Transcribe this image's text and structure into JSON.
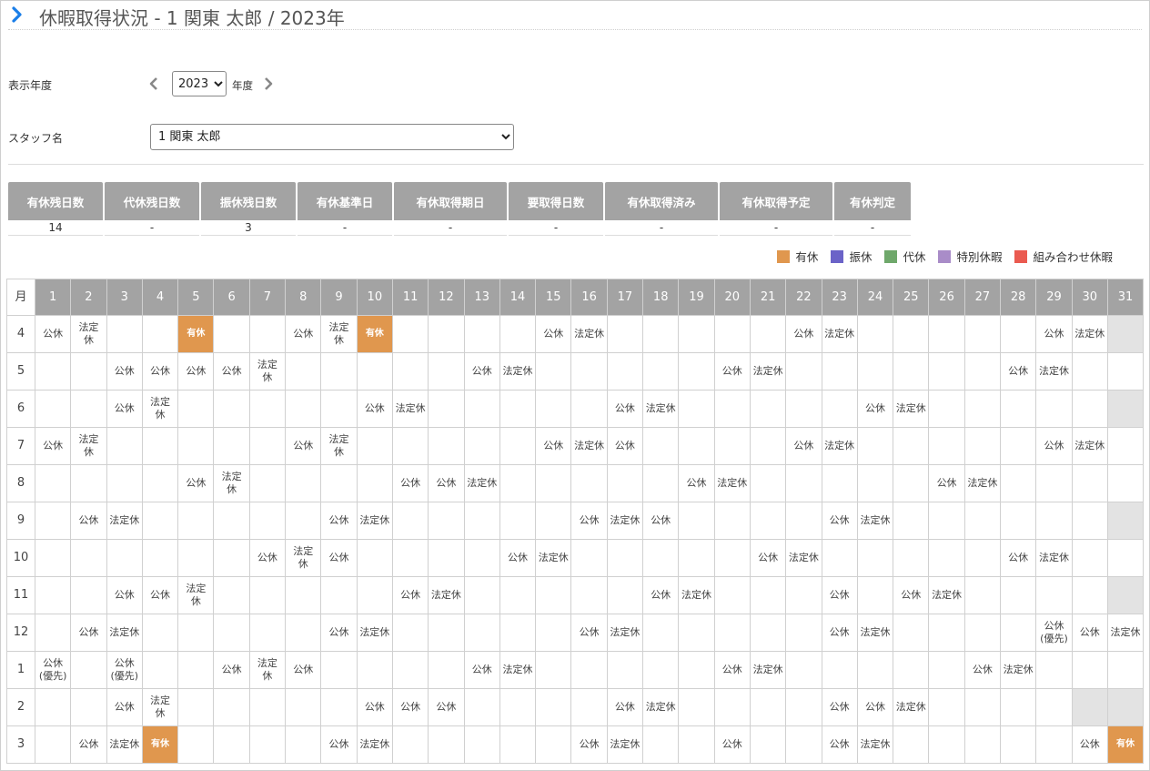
{
  "header": {
    "title": "休暇取得状況 - 1 関東 太郎 / 2023年"
  },
  "filters": {
    "year_label": "表示年度",
    "year_value": "2023",
    "year_unit": "年度",
    "staff_label": "スタッフ名",
    "staff_value": "1 関東 太郎"
  },
  "summary": [
    {
      "label": "有休残日数",
      "value": "14"
    },
    {
      "label": "代休残日数",
      "value": "-"
    },
    {
      "label": "振休残日数",
      "value": "3"
    },
    {
      "label": "有休基準日",
      "value": "-"
    },
    {
      "label": "有休取得期日",
      "value": "-"
    },
    {
      "label": "要取得日数",
      "value": "-"
    },
    {
      "label": "有休取得済み",
      "value": "-"
    },
    {
      "label": "有休取得予定",
      "value": "-"
    },
    {
      "label": "有休判定",
      "value": "-"
    }
  ],
  "legend": [
    {
      "label": "有休",
      "color": "#e0974e"
    },
    {
      "label": "振休",
      "color": "#6b63c8"
    },
    {
      "label": "代休",
      "color": "#6fa86b"
    },
    {
      "label": "特別休暇",
      "color": "#a98cc8"
    },
    {
      "label": "組み合わせ休暇",
      "color": "#ea5a50"
    }
  ],
  "calendar": {
    "month_header": "月",
    "days": [
      "1",
      "2",
      "3",
      "4",
      "5",
      "6",
      "7",
      "8",
      "9",
      "10",
      "11",
      "12",
      "13",
      "14",
      "15",
      "16",
      "17",
      "18",
      "19",
      "20",
      "21",
      "22",
      "23",
      "24",
      "25",
      "26",
      "27",
      "28",
      "29",
      "30",
      "31"
    ],
    "rows": [
      {
        "month": "4",
        "days_in_month": 30,
        "cells": {
          "1": "公休",
          "2": "法定\n休",
          "5": "有休",
          "8": "公休",
          "9": "法定\n休",
          "10": "有休",
          "15": "公休",
          "16": "法定休",
          "22": "公休",
          "23": "法定休",
          "29": "公休",
          "30": "法定休"
        }
      },
      {
        "month": "5",
        "days_in_month": 31,
        "cells": {
          "3": "公休",
          "4": "公休",
          "5": "公休",
          "6": "公休",
          "7": "法定\n休",
          "13": "公休",
          "14": "法定休",
          "20": "公休",
          "21": "法定休",
          "28": "公休",
          "29": "法定休"
        }
      },
      {
        "month": "6",
        "days_in_month": 30,
        "cells": {
          "3": "公休",
          "4": "法定\n休",
          "10": "公休",
          "11": "法定休",
          "17": "公休",
          "18": "法定休",
          "24": "公休",
          "25": "法定休"
        }
      },
      {
        "month": "7",
        "days_in_month": 31,
        "cells": {
          "1": "公休",
          "2": "法定\n休",
          "8": "公休",
          "9": "法定\n休",
          "15": "公休",
          "16": "法定休",
          "17": "公休",
          "22": "公休",
          "23": "法定休",
          "29": "公休",
          "30": "法定休"
        }
      },
      {
        "month": "8",
        "days_in_month": 31,
        "cells": {
          "5": "公休",
          "6": "法定\n休",
          "11": "公休",
          "12": "公休",
          "13": "法定休",
          "19": "公休",
          "20": "法定休",
          "26": "公休",
          "27": "法定休"
        }
      },
      {
        "month": "9",
        "days_in_month": 30,
        "cells": {
          "2": "公休",
          "3": "法定休",
          "9": "公休",
          "10": "法定休",
          "16": "公休",
          "17": "法定休",
          "18": "公休",
          "23": "公休",
          "24": "法定休"
        }
      },
      {
        "month": "10",
        "days_in_month": 31,
        "cells": {
          "7": "公休",
          "8": "法定\n休",
          "9": "公休",
          "14": "公休",
          "15": "法定休",
          "21": "公休",
          "22": "法定休",
          "28": "公休",
          "29": "法定休"
        }
      },
      {
        "month": "11",
        "days_in_month": 30,
        "cells": {
          "3": "公休",
          "4": "公休",
          "5": "法定\n休",
          "11": "公休",
          "12": "法定休",
          "18": "公休",
          "19": "法定休",
          "23": "公休",
          "25": "公休",
          "26": "法定休"
        }
      },
      {
        "month": "12",
        "days_in_month": 31,
        "cells": {
          "2": "公休",
          "3": "法定休",
          "9": "公休",
          "10": "法定休",
          "16": "公休",
          "17": "法定休",
          "23": "公休",
          "24": "法定休",
          "29": "公休\n(優先)",
          "30": "公休",
          "31": "法定休"
        }
      },
      {
        "month": "1",
        "days_in_month": 31,
        "cells": {
          "1": "公休\n(優先)",
          "3": "公休\n(優先)",
          "6": "公休",
          "7": "法定\n休",
          "8": "公休",
          "13": "公休",
          "14": "法定休",
          "20": "公休",
          "21": "法定休",
          "27": "公休",
          "28": "法定休"
        }
      },
      {
        "month": "2",
        "days_in_month": 29,
        "cells": {
          "3": "公休",
          "4": "法定\n休",
          "10": "公休",
          "11": "公休",
          "12": "公休",
          "17": "公休",
          "18": "法定休",
          "23": "公休",
          "24": "公休",
          "25": "法定休"
        }
      },
      {
        "month": "3",
        "days_in_month": 31,
        "cells": {
          "2": "公休",
          "3": "法定休",
          "4": "有休",
          "9": "公休",
          "10": "法定休",
          "16": "公休",
          "17": "法定休",
          "20": "公休",
          "23": "公休",
          "24": "法定休",
          "30": "公休",
          "31": "有休"
        }
      }
    ]
  }
}
